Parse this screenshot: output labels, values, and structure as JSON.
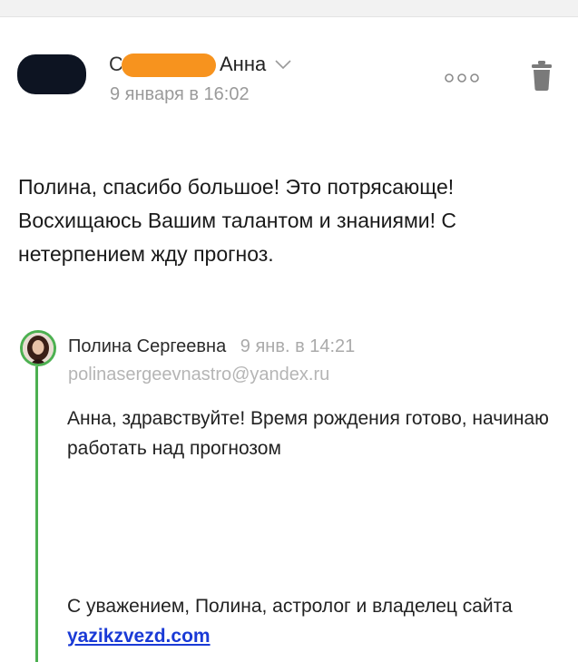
{
  "header": {
    "sender_initial": "С",
    "sender_name": "Анна",
    "date": "9 января в 16:02"
  },
  "icons": {
    "more": "more-dots-icon",
    "trash": "trash-icon",
    "expand": "chevron-down-icon"
  },
  "message": {
    "body": "Полина, спасибо большое! Это потрясающе! Восхищаюсь Вашим талантом и знаниями! С нетерпением жду прогноз."
  },
  "quoted": {
    "author": "Полина Сергеевна",
    "date": "9 янв. в 14:21",
    "email": "polinasergeevnastro@yandex.ru",
    "text": "Анна, здравствуйте! Время рождения готово, начинаю работать над прогнозом",
    "signature_prefix": "С уважением, Полина, астролог и владелец сайта",
    "site_link": "yazikzvezd.com"
  },
  "colors": {
    "quote_accent": "#4cb050",
    "link": "#1a3ad6",
    "redaction": "#f7931e"
  }
}
